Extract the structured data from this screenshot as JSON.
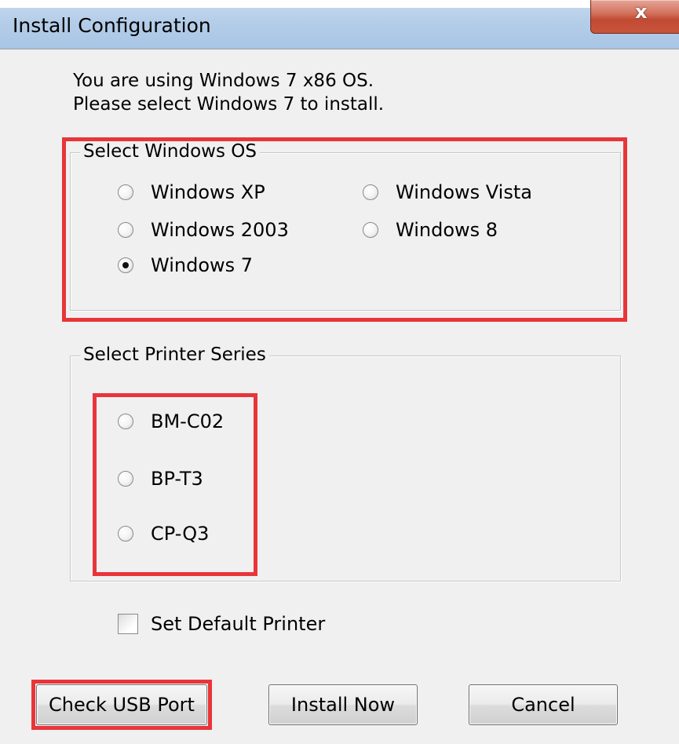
{
  "window": {
    "title": "Install Configuration",
    "close_glyph": "x",
    "colors": {
      "title_bar": "#b4cde8",
      "close_button": "#c94a33",
      "background": "#f0f0f0",
      "highlight": "#e8353a"
    }
  },
  "info": {
    "line1": "You are using Windows 7 x86 OS.",
    "line2": "Please select Windows 7 to install."
  },
  "os_group": {
    "label": "Select Windows OS",
    "selected": "Windows 7",
    "options": [
      {
        "label": "Windows XP",
        "checked": false
      },
      {
        "label": "Windows 2003",
        "checked": false
      },
      {
        "label": "Windows 7",
        "checked": true
      },
      {
        "label": "Windows Vista",
        "checked": false
      },
      {
        "label": "Windows 8",
        "checked": false
      }
    ]
  },
  "printer_group": {
    "label": "Select Printer Series",
    "options": [
      {
        "label": "BM-C02",
        "checked": false
      },
      {
        "label": "BP-T3",
        "checked": false
      },
      {
        "label": "CP-Q3",
        "checked": false
      }
    ]
  },
  "default_printer": {
    "label": "Set Default Printer",
    "checked": false
  },
  "buttons": {
    "check_usb": "Check USB Port",
    "install_now": "Install Now",
    "cancel": "Cancel"
  },
  "icons": {
    "close": "close-icon",
    "radio_selected": "radio-selected-icon",
    "radio_unselected": "radio-unselected-icon",
    "checkbox_unchecked": "checkbox-unchecked-icon"
  }
}
